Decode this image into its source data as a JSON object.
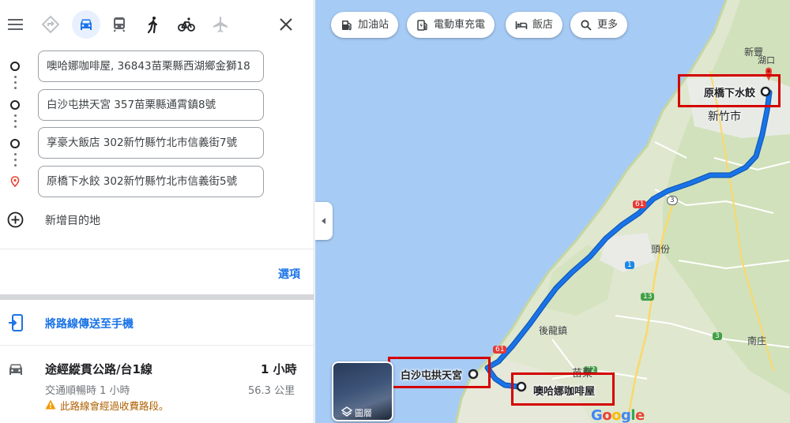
{
  "panel": {
    "travel_modes": [
      {
        "name": "best-route",
        "icon": "diamond-turn-icon",
        "active": false
      },
      {
        "name": "driving",
        "icon": "car-icon",
        "active": true
      },
      {
        "name": "transit",
        "icon": "train-icon",
        "active": false
      },
      {
        "name": "walking",
        "icon": "walk-icon",
        "active": false
      },
      {
        "name": "cycling",
        "icon": "bike-icon",
        "active": false
      },
      {
        "name": "flight",
        "icon": "plane-icon",
        "active": false
      }
    ],
    "waypoints": [
      "噢哈娜咖啡屋, 36843苗栗縣西湖鄉金獅18",
      "白沙屯拱天宮 357苗栗縣通霄鎮8號",
      "享豪大飯店 302新竹縣竹北市信義街7號",
      "原橋下水餃 302新竹縣竹北市信義街5號"
    ],
    "add_destination": "新增目的地",
    "options": "選項",
    "send_to_phone": "將路線傳送至手機",
    "route": {
      "name": "途經縱貫公路/台1線",
      "duration": "1 小時",
      "traffic": "交通順暢時 1 小時",
      "distance": "56.3 公里",
      "warning": "此路線會經過收費路段。"
    }
  },
  "map": {
    "chips": [
      "加油站",
      "電動車充電",
      "飯店",
      "更多"
    ],
    "layers_label": "圖層",
    "place_labels": [
      "原橋下水餃",
      "白沙屯拱天宮",
      "噢哈娜咖啡屋"
    ],
    "area_labels": [
      "新豐",
      "湖口",
      "新竹市",
      "頭份",
      "後龍鎮",
      "苗栗",
      "南庄"
    ],
    "road_shields": [
      "61",
      "3",
      "1",
      "13",
      "72",
      "3",
      "61"
    ],
    "route_color": "#1a73e8",
    "highlight_color": "#d40000",
    "logo_text": "Google"
  }
}
